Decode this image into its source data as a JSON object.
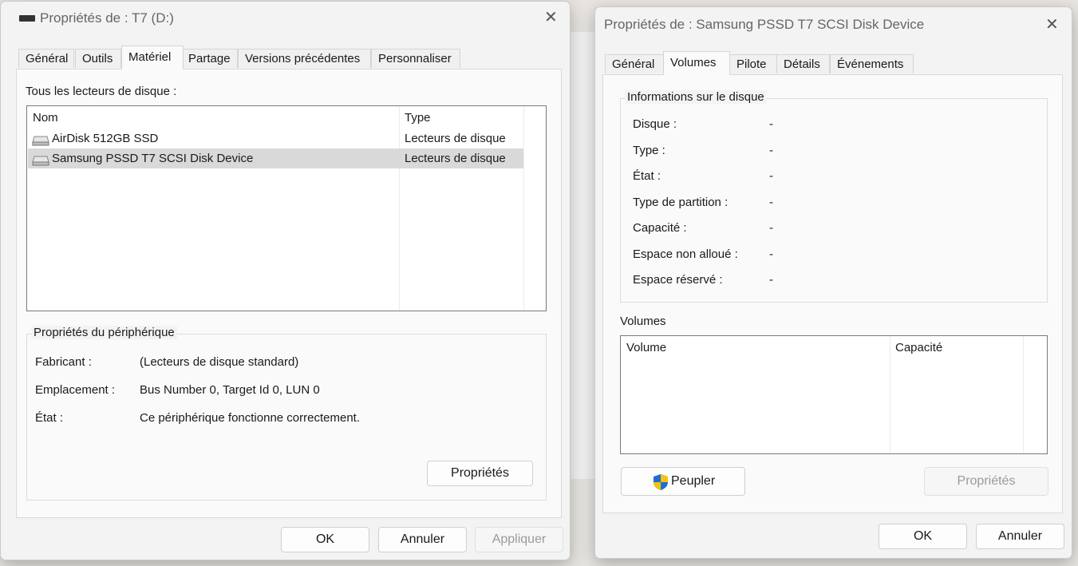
{
  "win1": {
    "title": "Propriétés de : T7 (D:)",
    "tabs": [
      "Général",
      "Outils",
      "Matériel",
      "Partage",
      "Versions précédentes",
      "Personnaliser"
    ],
    "active_tab": "Matériel",
    "list_caption": "Tous les lecteurs de disque :",
    "columns": {
      "name": "Nom",
      "type": "Type"
    },
    "rows": [
      {
        "name": "AirDisk 512GB SSD",
        "type": "Lecteurs de disque",
        "selected": false
      },
      {
        "name": "Samsung PSSD T7 SCSI Disk Device",
        "type": "Lecteurs de disque",
        "selected": true
      }
    ],
    "device_props": {
      "legend": "Propriétés du périphérique",
      "manufacturer_label": "Fabricant :",
      "manufacturer_value": "(Lecteurs de disque standard)",
      "location_label": "Emplacement :",
      "location_value": "Bus Number 0, Target Id 0, LUN 0",
      "status_label": "État :",
      "status_value": "Ce périphérique fonctionne correctement.",
      "properties_button": "Propriétés"
    },
    "buttons": {
      "ok": "OK",
      "cancel": "Annuler",
      "apply": "Appliquer"
    }
  },
  "win2": {
    "title": "Propriétés de : Samsung PSSD T7 SCSI Disk Device",
    "tabs": [
      "Général",
      "Volumes",
      "Pilote",
      "Détails",
      "Événements"
    ],
    "active_tab": "Volumes",
    "disk_info": {
      "legend": "Informations sur le disque",
      "fields": [
        {
          "label": "Disque :",
          "value": "-"
        },
        {
          "label": "Type :",
          "value": "-"
        },
        {
          "label": "État :",
          "value": "-"
        },
        {
          "label": "Type de partition :",
          "value": "-"
        },
        {
          "label": "Capacité :",
          "value": "-"
        },
        {
          "label": "Espace non alloué :",
          "value": "-"
        },
        {
          "label": "Espace réservé :",
          "value": "-"
        }
      ]
    },
    "volumes_caption": "Volumes",
    "volumes_columns": {
      "volume": "Volume",
      "capacity": "Capacité"
    },
    "populate_button": "Peupler",
    "properties_button": "Propriétés",
    "buttons": {
      "ok": "OK",
      "cancel": "Annuler"
    }
  },
  "icons": {
    "drive": "drive-icon",
    "shield": "uac-shield-icon",
    "close": "close-icon",
    "title_drive": "drive-icon"
  },
  "colors": {
    "selected_row": "#d9d9d9",
    "shield_blue": "#1f6fd0",
    "shield_yellow": "#f5c211"
  }
}
